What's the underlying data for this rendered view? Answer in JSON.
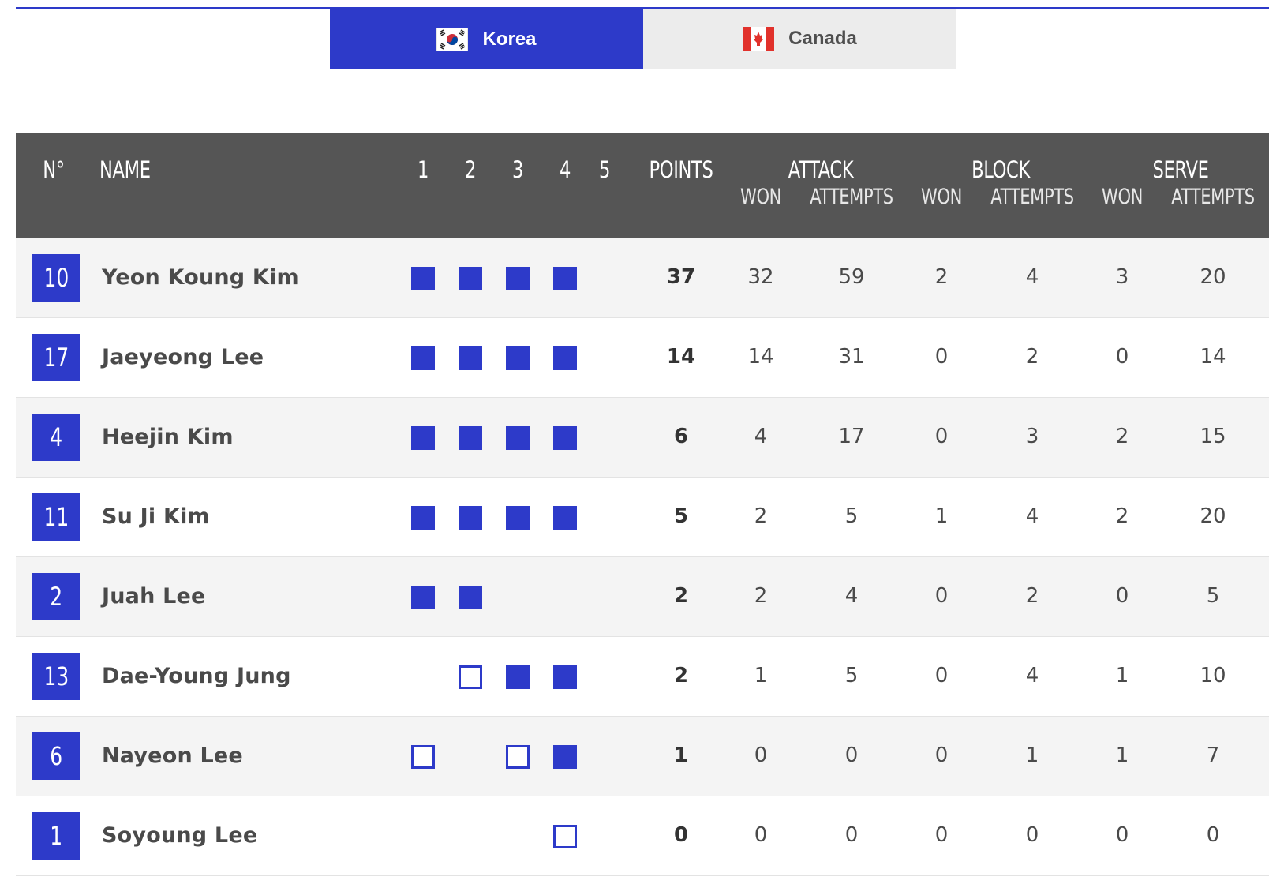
{
  "tabs": [
    {
      "label": "Korea",
      "flag": "south-korea-flag",
      "active": true
    },
    {
      "label": "Canada",
      "flag": "canada-flag",
      "active": false
    }
  ],
  "colors": {
    "accent": "#2d3ac9",
    "header_bg": "#555555"
  },
  "table": {
    "headers": {
      "number": "N°",
      "name": "NAME",
      "sets": [
        "1",
        "2",
        "3",
        "4",
        "5"
      ],
      "points": "POINTS",
      "attack": "ATTACK",
      "block": "BLOCK",
      "serve": "SERVE",
      "won": "WON",
      "attempts": "ATTEMPTS"
    },
    "rows": [
      {
        "number": "10",
        "name": "Yeon Koung Kim",
        "sets": [
          "started",
          "started",
          "started",
          "started",
          ""
        ],
        "points": "37",
        "attack_won": "32",
        "attack_attempts": "59",
        "block_won": "2",
        "block_attempts": "4",
        "serve_won": "3",
        "serve_attempts": "20"
      },
      {
        "number": "17",
        "name": "Jaeyeong Lee",
        "sets": [
          "started",
          "started",
          "started",
          "started",
          ""
        ],
        "points": "14",
        "attack_won": "14",
        "attack_attempts": "31",
        "block_won": "0",
        "block_attempts": "2",
        "serve_won": "0",
        "serve_attempts": "14"
      },
      {
        "number": "4",
        "name": "Heejin Kim",
        "sets": [
          "started",
          "started",
          "started",
          "started",
          ""
        ],
        "points": "6",
        "attack_won": "4",
        "attack_attempts": "17",
        "block_won": "0",
        "block_attempts": "3",
        "serve_won": "2",
        "serve_attempts": "15"
      },
      {
        "number": "11",
        "name": "Su Ji Kim",
        "sets": [
          "started",
          "started",
          "started",
          "started",
          ""
        ],
        "points": "5",
        "attack_won": "2",
        "attack_attempts": "5",
        "block_won": "1",
        "block_attempts": "4",
        "serve_won": "2",
        "serve_attempts": "20"
      },
      {
        "number": "2",
        "name": "Juah Lee",
        "sets": [
          "started",
          "started",
          "",
          "",
          ""
        ],
        "points": "2",
        "attack_won": "2",
        "attack_attempts": "4",
        "block_won": "0",
        "block_attempts": "2",
        "serve_won": "0",
        "serve_attempts": "5"
      },
      {
        "number": "13",
        "name": "Dae-Young Jung",
        "sets": [
          "",
          "sub",
          "started",
          "started",
          ""
        ],
        "points": "2",
        "attack_won": "1",
        "attack_attempts": "5",
        "block_won": "0",
        "block_attempts": "4",
        "serve_won": "1",
        "serve_attempts": "10"
      },
      {
        "number": "6",
        "name": "Nayeon Lee",
        "sets": [
          "sub",
          "",
          "sub",
          "started",
          ""
        ],
        "points": "1",
        "attack_won": "0",
        "attack_attempts": "0",
        "block_won": "0",
        "block_attempts": "1",
        "serve_won": "1",
        "serve_attempts": "7"
      },
      {
        "number": "1",
        "name": "Soyoung Lee",
        "sets": [
          "",
          "",
          "",
          "sub",
          ""
        ],
        "points": "0",
        "attack_won": "0",
        "attack_attempts": "0",
        "block_won": "0",
        "block_attempts": "0",
        "serve_won": "0",
        "serve_attempts": "0"
      }
    ]
  }
}
